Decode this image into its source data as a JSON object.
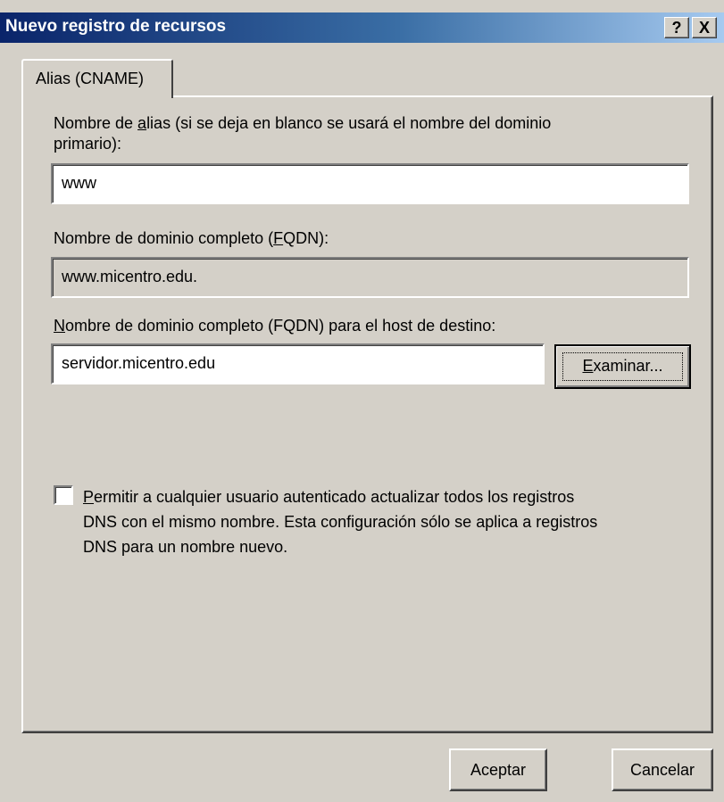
{
  "window": {
    "title": "Nuevo registro de recursos",
    "help_label": "?",
    "close_label": "X"
  },
  "tab": {
    "label": "Alias (CNAME)"
  },
  "alias": {
    "label_line1_pre": "Nombre de ",
    "label_line1_mnemonic": "a",
    "label_line1_post": "lias (si se deja en blanco se usará el nombre del dominio",
    "label_line2": "primario):",
    "value": "www"
  },
  "fqdn": {
    "label_pre": "Nombre de dominio completo (",
    "label_mnemonic": "F",
    "label_post": "QDN):",
    "value": "www.micentro.edu."
  },
  "target": {
    "label_mnemonic": "N",
    "label_post": "ombre de dominio completo (FQDN) para el host de destino:",
    "value": "servidor.micentro.edu",
    "browse_mnemonic": "E",
    "browse_post": "xaminar..."
  },
  "permission": {
    "checked": false,
    "line1_mnemonic": "P",
    "line1_post": "ermitir a cualquier usuario autenticado actualizar todos los registros",
    "line2": "DNS con el mismo nombre. Esta configuración sólo se aplica a registros",
    "line3": "DNS para un nombre nuevo."
  },
  "buttons": {
    "ok_label": "Aceptar",
    "cancel_label": "Cancelar"
  }
}
